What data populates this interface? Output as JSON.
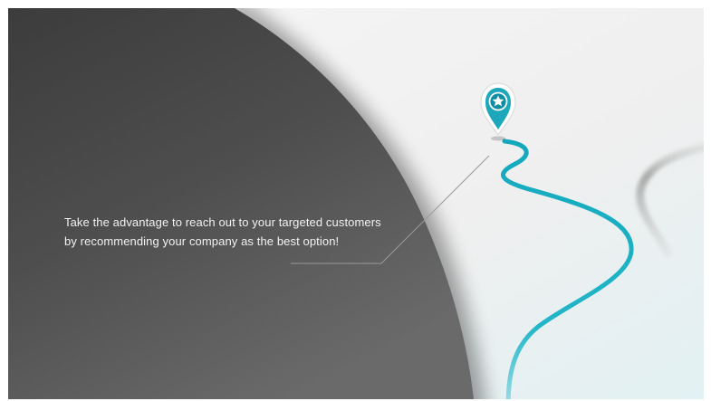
{
  "slide": {
    "caption": {
      "line1": "Take the advantage to reach out to your targeted customers",
      "line2": "by recommending your company as the best option!"
    },
    "pin_icon": "map-pin-star-icon"
  },
  "colors": {
    "dark_panel": "#4a4a4a",
    "background": "#f1f1f1",
    "road_accent": "#1fb1c4",
    "road_secondary": "#b9b9b9",
    "text": "#f2f2f2"
  }
}
